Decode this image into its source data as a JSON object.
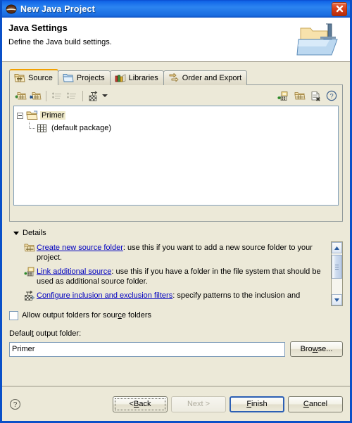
{
  "window": {
    "title": "New Java Project",
    "title_icon": "eclipse-globe-icon",
    "close_label": "close-icon"
  },
  "header": {
    "title": "Java Settings",
    "subtitle": "Define the Java build settings.",
    "icon": "java-project-folder-icon"
  },
  "tabs": [
    {
      "label": "Source",
      "icon": "source-folder-icon",
      "active": true
    },
    {
      "label": "Projects",
      "icon": "projects-folder-icon",
      "active": false
    },
    {
      "label": "Libraries",
      "icon": "libraries-books-icon",
      "active": false
    },
    {
      "label": "Order and Export",
      "icon": "order-export-icon",
      "active": false
    }
  ],
  "toolbar": {
    "left": [
      {
        "name": "add-folder-icon",
        "enabled": true
      },
      {
        "name": "link-source-icon",
        "enabled": true
      },
      {
        "name": "edit-filter-icon",
        "enabled": false
      },
      {
        "name": "remove-filter-icon",
        "enabled": false
      },
      {
        "name": "configure-filters-icon",
        "enabled": true
      }
    ],
    "dropdown_arrow": "chevron-down-icon",
    "right": [
      {
        "name": "link-additional-source-icon"
      },
      {
        "name": "create-new-source-folder-icon"
      },
      {
        "name": "remove-from-buildpath-icon"
      },
      {
        "name": "help-icon"
      }
    ]
  },
  "tree": {
    "root": {
      "label": "Primer",
      "icon": "source-folder-icon",
      "expanded": true,
      "selected": true
    },
    "children": [
      {
        "label": "(default package)",
        "icon": "package-icon"
      }
    ]
  },
  "details": {
    "header_label": "Details",
    "expanded": true,
    "entries": [
      {
        "icon": "create-new-source-folder-icon",
        "link": "Create new source folder",
        "text": ": use this if you want to add a new source folder to your project."
      },
      {
        "icon": "link-additional-source-icon",
        "link": "Link additional source",
        "text": ": use this if you have a folder in the file system that should be used as additional source folder."
      },
      {
        "icon": "configure-filters-icon",
        "link": "Configure inclusion and exclusion filters",
        "text": ": specify patterns to the inclusion and"
      }
    ],
    "scrollbar": {
      "up_arrow": "scroll-up-icon",
      "down_arrow": "scroll-down-icon"
    }
  },
  "allow_output": {
    "label_pre": "Allow output folders for sour",
    "label_mnemonic": "c",
    "label_post": "e folders",
    "checked": false
  },
  "output_folder": {
    "label_pre": "Defaul",
    "label_mnemonic": "t",
    "label_post": " output folder:",
    "value": "Primer",
    "placeholder": "",
    "browse_pre": "Bro",
    "browse_mnemonic": "w",
    "browse_post": "se..."
  },
  "footer": {
    "help_icon": "help-icon",
    "buttons": [
      {
        "name": "back-button",
        "pre": "< ",
        "mnemonic": "B",
        "post": "ack",
        "enabled": true,
        "default": false,
        "focused": true
      },
      {
        "name": "next-button",
        "pre": "",
        "mnemonic": "N",
        "post": "ext >",
        "enabled": false,
        "default": false,
        "focused": false
      },
      {
        "name": "finish-button",
        "pre": "",
        "mnemonic": "F",
        "post": "inish",
        "enabled": true,
        "default": true,
        "focused": false
      },
      {
        "name": "cancel-button",
        "pre": "",
        "mnemonic": "C",
        "post": "ancel",
        "enabled": true,
        "default": false,
        "focused": false
      }
    ]
  },
  "colors": {
    "titlebar_blue": "#1267E8",
    "dialog_bg": "#ECE9D8",
    "tab_active_accent": "#F2A000",
    "link_blue": "#0000C0",
    "border_gray": "#919B9C",
    "field_border": "#7F9DB9"
  }
}
